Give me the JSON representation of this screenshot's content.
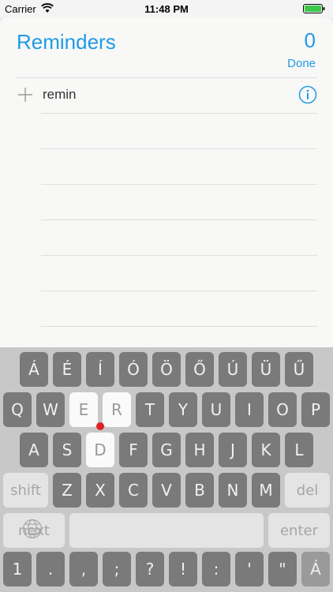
{
  "status_bar": {
    "carrier": "Carrier",
    "time": "11:48 PM"
  },
  "reminders": {
    "title": "Reminders",
    "count": "0",
    "done_label": "Done",
    "item_text": "remin"
  },
  "keyboard": {
    "row_accents": [
      "Á",
      "É",
      "Í",
      "Ó",
      "Ö",
      "Ő",
      "Ú",
      "Ü",
      "Ű"
    ],
    "row1": [
      "Q",
      "W",
      "E",
      "R",
      "T",
      "Y",
      "U",
      "I",
      "O",
      "P"
    ],
    "row2": [
      "A",
      "S",
      "D",
      "F",
      "G",
      "H",
      "J",
      "K",
      "L"
    ],
    "row3": [
      "Z",
      "X",
      "C",
      "V",
      "B",
      "N",
      "M"
    ],
    "shift_label": "shift",
    "del_label": "del",
    "next_label": "next",
    "enter_label": "enter",
    "row5": [
      "1",
      ".",
      ",",
      ";",
      "?",
      "!",
      ":",
      "'",
      "\""
    ],
    "row5_last": "Á"
  },
  "colors": {
    "accent": "#1f9be6",
    "key_dark": "#7a7a7a",
    "key_light": "#fafafa",
    "indicator": "#dd2222"
  }
}
